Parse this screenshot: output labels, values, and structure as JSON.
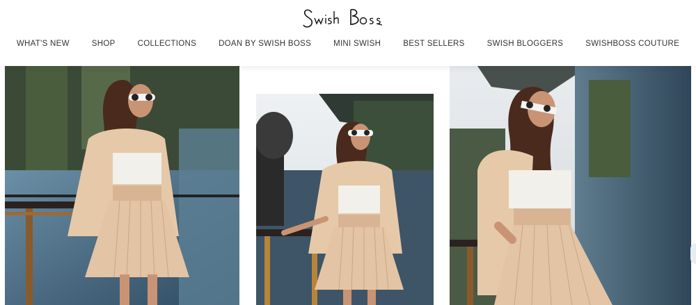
{
  "brand": {
    "logo_text": "Swish Boss"
  },
  "nav": {
    "items": [
      {
        "label": "WHAT'S NEW"
      },
      {
        "label": "SHOP"
      },
      {
        "label": "COLLECTIONS"
      },
      {
        "label": "DOAN BY SWISH BOSS"
      },
      {
        "label": "MINI SWISH"
      },
      {
        "label": "BEST SELLERS"
      },
      {
        "label": "SWISH BLOGGERS"
      },
      {
        "label": "SWISHBOSS COUTURE"
      }
    ]
  },
  "gallery": {
    "images": [
      {
        "name": "model-photo-1"
      },
      {
        "name": "model-photo-2"
      },
      {
        "name": "model-photo-3"
      }
    ]
  }
}
